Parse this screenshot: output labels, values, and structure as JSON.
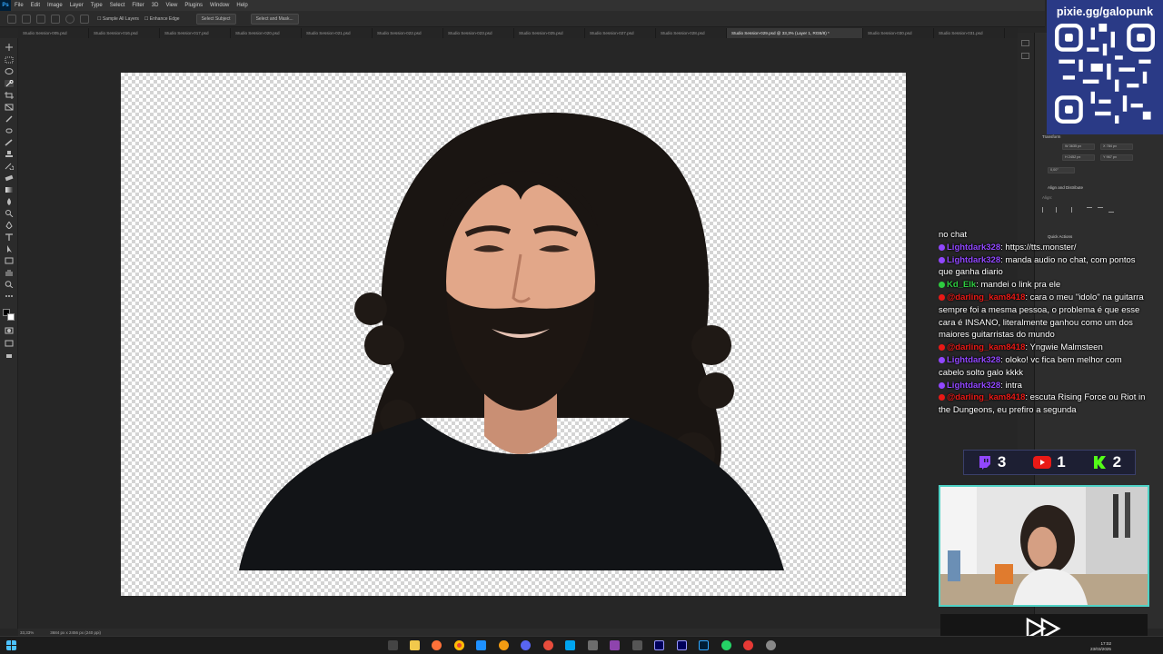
{
  "menu": {
    "app_logo": "Ps",
    "items": [
      "File",
      "Edit",
      "Image",
      "Layer",
      "Type",
      "Select",
      "Filter",
      "3D",
      "View",
      "Plugins",
      "Window",
      "Help"
    ]
  },
  "options_bar": {
    "sample_all_layers": "Sample All Layers",
    "enhance_edge": "Enhance Edge",
    "select_subject": "Select Subject",
    "select_and_mask": "Select and Mask..."
  },
  "tabs": [
    "Studio Session-005.psd",
    "Studio Session-016.psd",
    "Studio Session-017.psd",
    "Studio Session-020.psd",
    "Studio Session-021.psd",
    "Studio Session-022.psd",
    "Studio Session-023.psd",
    "Studio Session-025.psd",
    "Studio Session-027.psd",
    "Studio Session-028.psd",
    "Studio Session-029.psd @ 33,3% (Layer 1, RGB/8) *",
    "Studio Session-030.psd",
    "Studio Session-031.psd"
  ],
  "status": {
    "zoom": "33,33%",
    "doc_size": "3684 px x 2456 px (240 ppi)"
  },
  "properties": {
    "transform_title": "Transform",
    "w": "W 3635 px",
    "h": "H 2452 px",
    "x": "X 784 px",
    "y": "Y 967 px",
    "angle": "0,00°",
    "align_title": "Align and Distribute",
    "align_label": "Align:",
    "quick_actions_title": "Quick Actions"
  },
  "qr": {
    "title": "pixie.gg/galopunk"
  },
  "chat": [
    {
      "badge": "",
      "user": "",
      "color": "",
      "text": "no chat"
    },
    {
      "badge": "#9147ff",
      "user": "Lightdark328",
      "color": "purple",
      "text": ": https://tts.monster/"
    },
    {
      "badge": "#9147ff",
      "user": "Lightdark328",
      "color": "purple",
      "text": ": manda audio no chat, com pontos que ganha diario"
    },
    {
      "badge": "#2ecc40",
      "user": "Kd_Elk",
      "color": "green",
      "text": ": mandei o link pra ele"
    },
    {
      "badge": "#e91916",
      "user": "@darling_kam8418",
      "color": "red",
      "text": ": cara o meu \"idolo\" na guitarra sempre foi a mesma pessoa, o problema é que esse cara é INSANO, literalmente ganhou como um dos maiores guitarristas do mundo"
    },
    {
      "badge": "#e91916",
      "user": "@darling_kam8418",
      "color": "red",
      "text": ": Yngwie Malmsteen"
    },
    {
      "badge": "#9147ff",
      "user": "Lightdark328",
      "color": "purple",
      "text": ": oloko! vc fica bem melhor com cabelo solto galo kkkk"
    },
    {
      "badge": "#9147ff",
      "user": "Lightdark328",
      "color": "purple",
      "text": ": intra"
    },
    {
      "badge": "#e91916",
      "user": "@darling_kam8418",
      "color": "red",
      "text": ": escuta Rising Force ou Riot in the Dungeons, eu prefiro a segunda"
    }
  ],
  "counters": {
    "twitch": "3",
    "youtube": "1",
    "kick": "2"
  },
  "clock": {
    "time": "17:02",
    "date": "23/03/2025"
  },
  "colors": {
    "accent": "#31a8ff",
    "qr_bg": "#2a3a86",
    "webcam_border": "#4fd1c5",
    "twitch": "#9147ff",
    "youtube": "#e91916",
    "kick": "#53fc18"
  }
}
